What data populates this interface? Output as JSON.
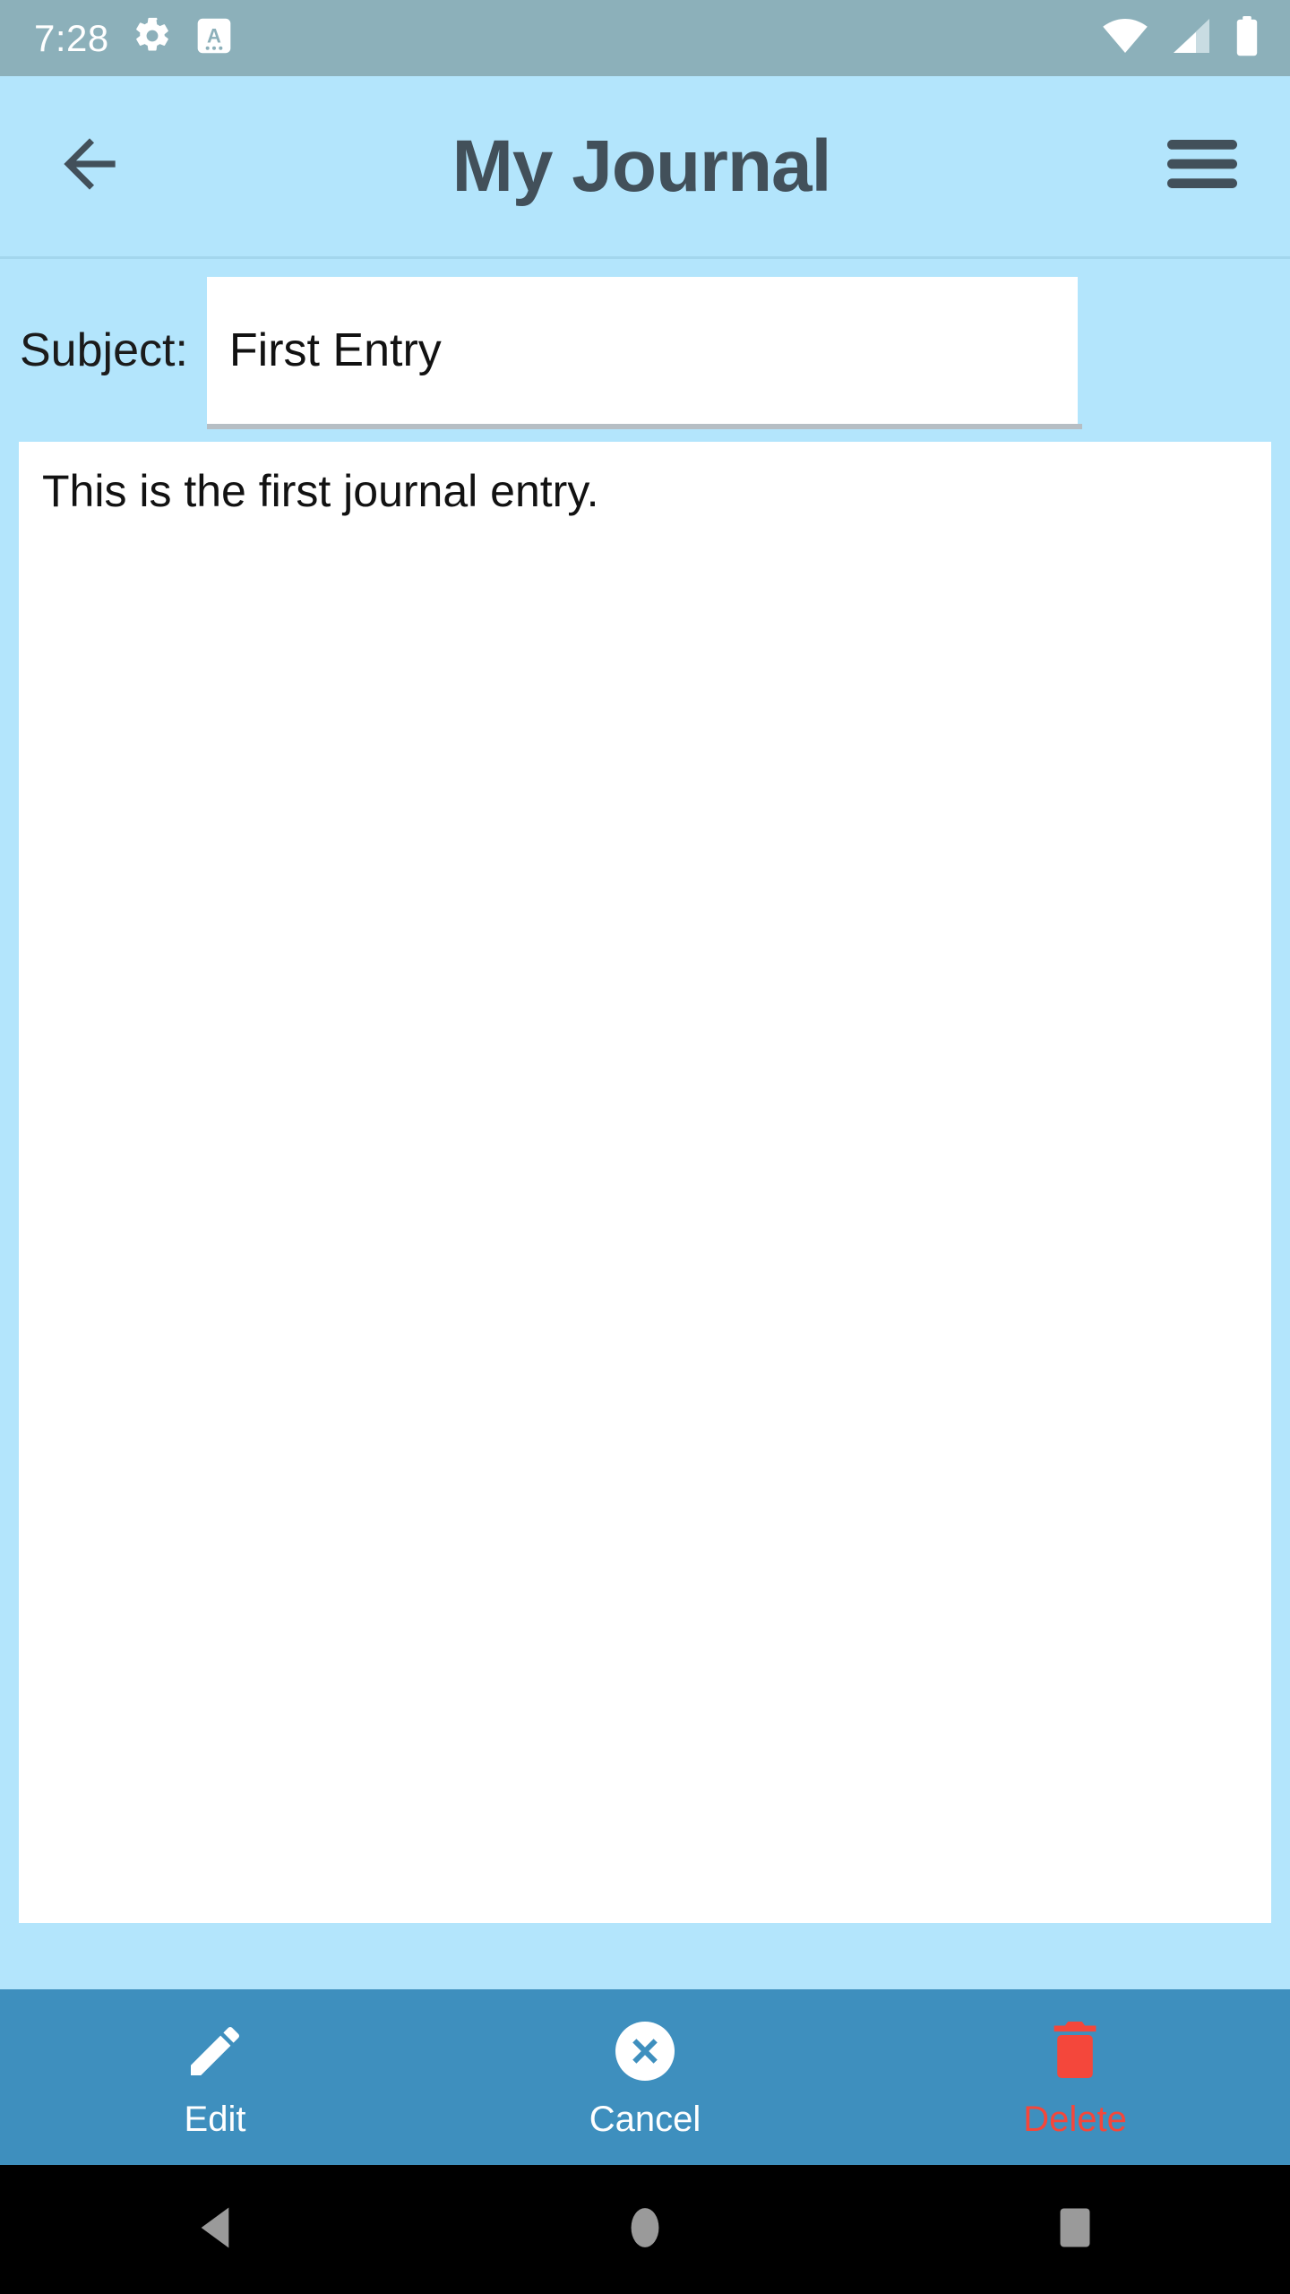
{
  "status_bar": {
    "clock": "7:28",
    "left_icons": [
      "gear-icon",
      "keyboard-language-icon"
    ],
    "right_icons": [
      "wifi-icon",
      "cell-signal-icon",
      "battery-icon"
    ],
    "background": "#8CB0BA",
    "foreground": "#FFFFFF"
  },
  "app_bar": {
    "back_icon": "arrow-left-icon",
    "title": "My Journal",
    "menu_icon": "hamburger-menu-icon",
    "background": "#B3E5FC",
    "title_color": "#42505A"
  },
  "form": {
    "subject_label": "Subject:",
    "subject_value": "First Entry",
    "subject_placeholder": "Subject",
    "body_value": "This is the first journal entry.",
    "body_placeholder": "Entry text"
  },
  "action_bar": {
    "background": "#3E8FBE",
    "items": [
      {
        "label": "Edit",
        "icon": "pencil-icon",
        "color": "#FFFFFF"
      },
      {
        "label": "Cancel",
        "icon": "circle-x-icon",
        "color": "#FFFFFF"
      },
      {
        "label": "Delete",
        "icon": "trash-can-icon",
        "color": "#F4473B"
      }
    ]
  },
  "nav_bar": {
    "background": "#000000",
    "icon_color": "#9A9A9A",
    "buttons": [
      {
        "name": "back",
        "icon": "triangle-back-icon"
      },
      {
        "name": "home",
        "icon": "circle-home-icon"
      },
      {
        "name": "recents",
        "icon": "square-recents-icon"
      }
    ]
  }
}
